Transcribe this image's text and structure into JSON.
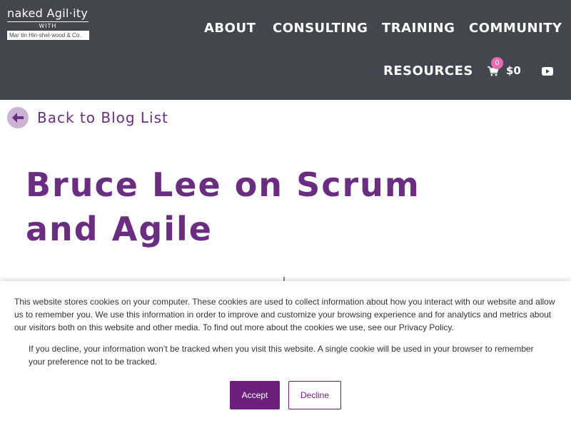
{
  "logo": {
    "brand": "naked Agil·ity",
    "with": "WITH",
    "sub": "Mar·tin Hin·shel·wood & Co."
  },
  "nav": {
    "items": [
      "ABOUT",
      "CONSULTING",
      "TRAINING",
      "COMMUNITY",
      "RESOURCES"
    ],
    "cart_count": "0",
    "cart_total": "$0"
  },
  "icons": {
    "cart": "shopping-cart-icon",
    "youtube": "youtube-icon",
    "back": "arrow-left-icon"
  },
  "back_link": {
    "label": "Back to Blog List"
  },
  "post": {
    "title": "Bruce Lee on Scrum and Agile"
  },
  "cookie": {
    "text": "This website stores cookies on your computer. These cookies are used to collect information about how you interact with our website and allow us to remember you. We use this information in order to improve and customize your browsing experience and for analytics and metrics about our visitors both on this website and other media. To find out more about the cookies we use, see our Privacy Policy.",
    "text2": "If you decline, your information won’t be tracked when you visit this website. A single cookie will be used in your browser to remember your preference not to be tracked.",
    "accept": "Accept",
    "decline": "Decline"
  },
  "colors": {
    "header_bg": "#44464f",
    "brand_purple": "#6b2d82",
    "badge_pink": "#e968b6"
  }
}
